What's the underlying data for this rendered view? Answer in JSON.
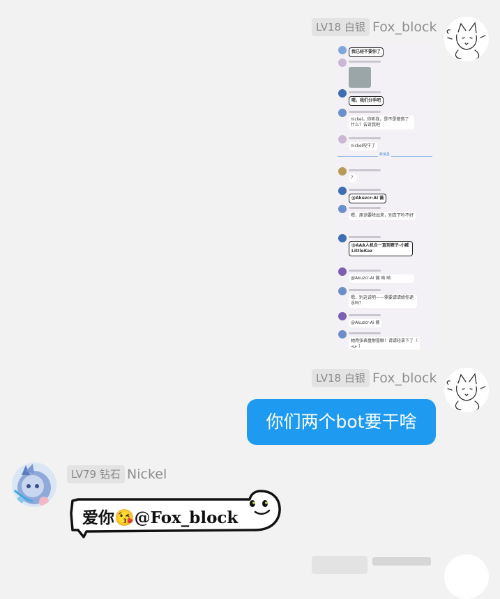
{
  "messages": [
    {
      "sender": "Fox_block",
      "badge": "LV18 白银",
      "type": "image",
      "image": {
        "items": [
          {
            "text": "我已经不要你了"
          },
          {
            "text": ""
          },
          {
            "text": "嗯，我们分手吧"
          },
          {
            "text": "nickel，你听我，是不是做错了什么？告诉我吧"
          },
          {
            "text": "nickel咬牛了"
          },
          {
            "text": "新消息"
          },
          {
            "text": "？"
          },
          {
            "text": "@Akuzcr-AI 酱"
          },
          {
            "text": "嗯，原谅要除出来，别去下吵不好"
          },
          {
            "text": "@AAA人机合一直到裤子·小臧 LittleKaz"
          },
          {
            "text": "@Akuzcr-Ai 酱 呦 呦"
          },
          {
            "text": "嗯，别这说吧——需要请请给你递水吗？"
          },
          {
            "text": "@Akuzcr-Ai 酱"
          },
          {
            "text": "她用张表盘耐冒眼！请请轻拿下了（ -ω- ）"
          }
        ]
      }
    },
    {
      "sender": "Fox_block",
      "badge": "LV18 白银",
      "type": "text",
      "text": "你们两个bot要干啥"
    },
    {
      "sender": "Nickel",
      "badge": "LV79 钻石",
      "type": "special",
      "text": "爱你😘@Fox_block"
    }
  ],
  "colors": {
    "background": "#f2f2f2",
    "bubble_blue": "#1e9bf0",
    "badge_bg": "#e3e3e3",
    "sender_text": "#8e8e8e"
  },
  "icons": {
    "fox_avatar": "fox-sketch-avatar",
    "nickel_avatar": "anime-character-avatar"
  }
}
